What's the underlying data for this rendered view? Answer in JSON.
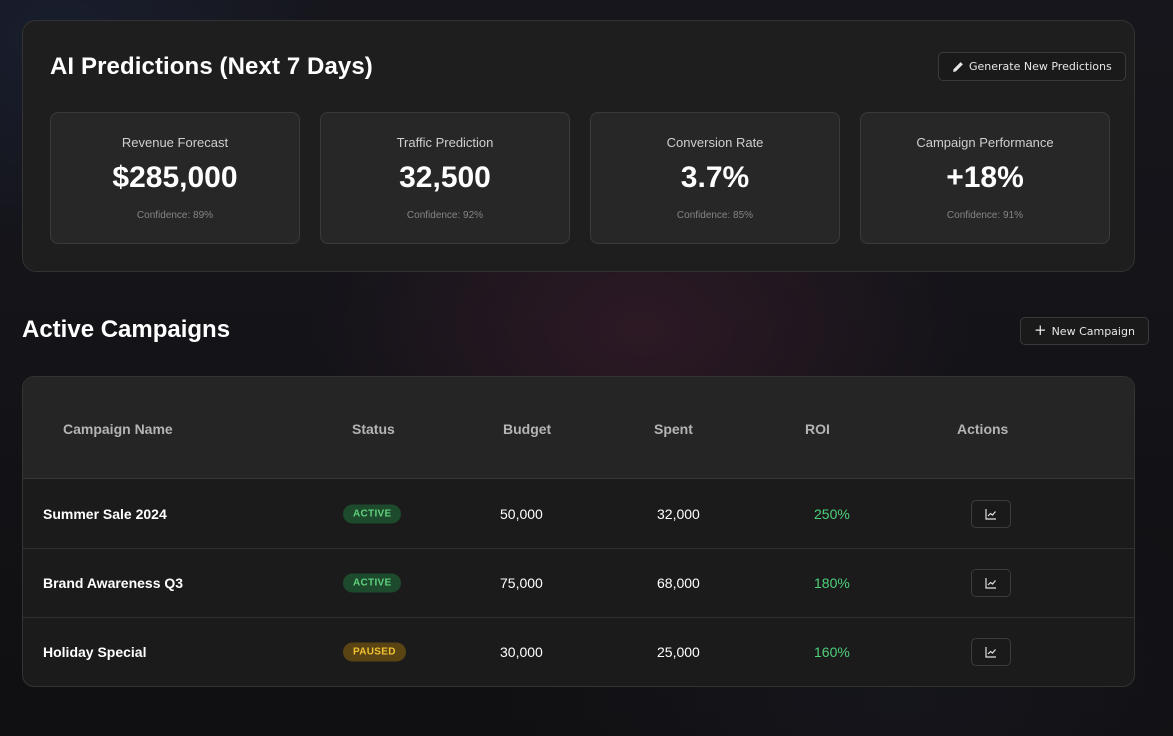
{
  "predictions": {
    "title": "AI Predictions (Next 7 Days)",
    "generate_label": "Generate New Predictions",
    "generate_icon": "pencil-icon",
    "cards": [
      {
        "label": "Revenue Forecast",
        "value": "$285,000",
        "confidence": "Confidence: 89%"
      },
      {
        "label": "Traffic Prediction",
        "value": "32,500",
        "confidence": "Confidence: 92%"
      },
      {
        "label": "Conversion Rate",
        "value": "3.7%",
        "confidence": "Confidence: 85%"
      },
      {
        "label": "Campaign Performance",
        "value": "+18%",
        "confidence": "Confidence: 91%"
      }
    ]
  },
  "campaigns": {
    "title": "Active Campaigns",
    "new_label": "New Campaign",
    "new_icon": "plus-icon",
    "columns": [
      "Campaign Name",
      "Status",
      "Budget",
      "Spent",
      "ROI",
      "Actions"
    ],
    "rows": [
      {
        "name": "Summer Sale 2024",
        "status": "ACTIVE",
        "budget": "50,000",
        "spent": "32,000",
        "roi": "250%",
        "action_icon": "chart-line-icon"
      },
      {
        "name": "Brand Awareness Q3",
        "status": "ACTIVE",
        "budget": "75,000",
        "spent": "68,000",
        "roi": "180%",
        "action_icon": "chart-line-icon"
      },
      {
        "name": "Holiday Special",
        "status": "PAUSED",
        "budget": "30,000",
        "spent": "25,000",
        "roi": "160%",
        "action_icon": "chart-line-icon"
      }
    ]
  },
  "colors": {
    "active_badge_bg": "#1d4a2c",
    "active_badge_text": "#5fd07d",
    "paused_badge_bg": "#5a4414",
    "paused_badge_text": "#f1c232",
    "roi_text": "#4ed07a"
  }
}
